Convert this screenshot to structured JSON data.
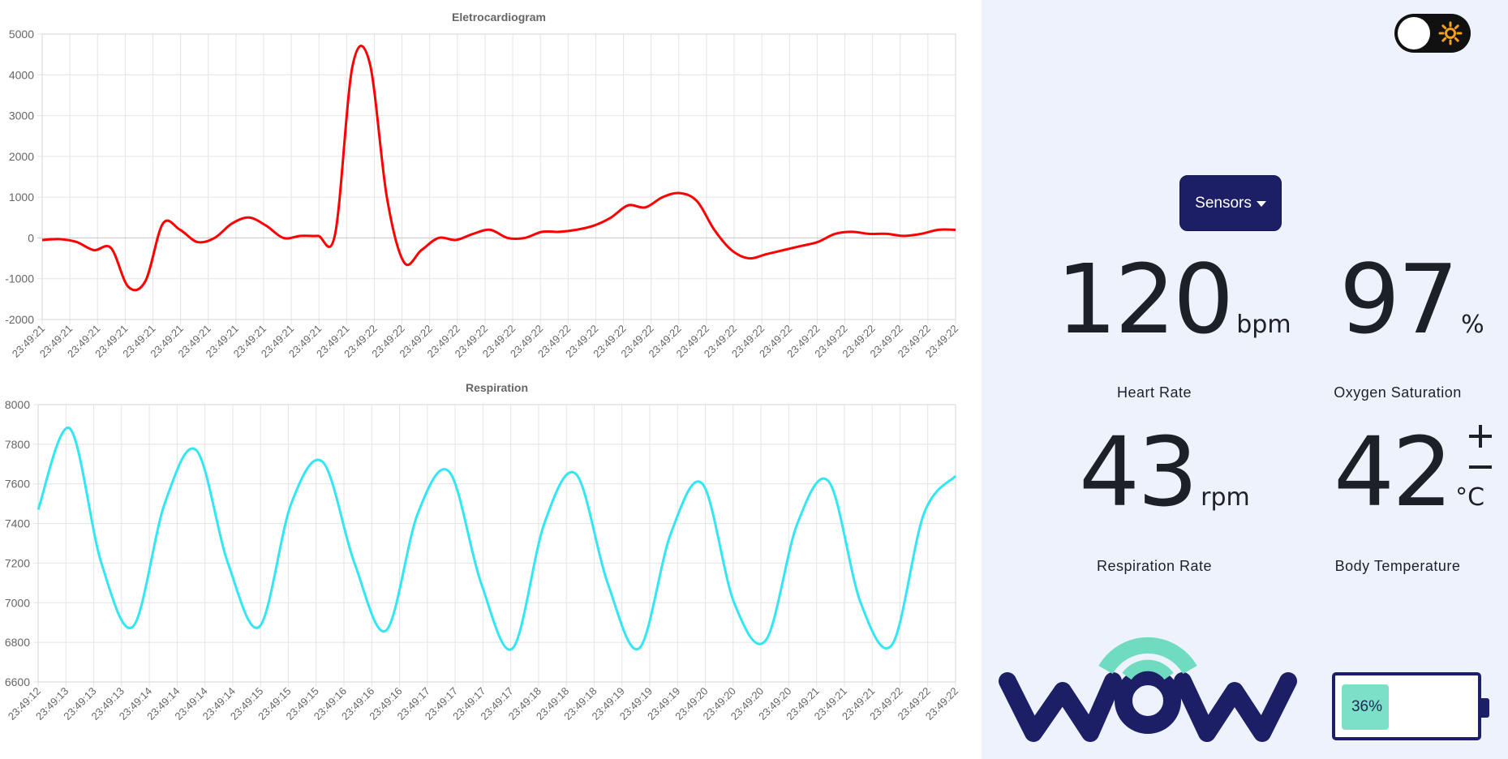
{
  "header": {
    "theme_toggle": {
      "state": "light",
      "icon": "sun-icon"
    }
  },
  "ecg_chart": {
    "chart_data": {
      "type": "line",
      "title": "Eletrocardiogram",
      "color": "#ff0000",
      "ylim": [
        -2000,
        5000
      ],
      "yticks": [
        -2000,
        -1000,
        0,
        1000,
        2000,
        3000,
        4000,
        5000
      ],
      "xticks": [
        "23:49:21",
        "23:49:21",
        "23:49:21",
        "23:49:21",
        "23:49:21",
        "23:49:21",
        "23:49:21",
        "23:49:21",
        "23:49:21",
        "23:49:21",
        "23:49:21",
        "23:49:21",
        "23:49:22",
        "23:49:22",
        "23:49:22",
        "23:49:22",
        "23:49:22",
        "23:49:22",
        "23:49:22",
        "23:49:22",
        "23:49:22",
        "23:49:22",
        "23:49:22",
        "23:49:22",
        "23:49:22",
        "23:49:22",
        "23:49:22",
        "23:49:22",
        "23:49:22",
        "23:49:22",
        "23:49:22",
        "23:49:22",
        "23:49:22",
        "23:49:22"
      ],
      "grid": true,
      "values": [
        -50,
        -30,
        -100,
        -300,
        -250,
        -1200,
        -1050,
        350,
        200,
        -100,
        0,
        350,
        500,
        300,
        0,
        50,
        50,
        100,
        4200,
        4300,
        1000,
        -600,
        -300,
        0,
        -50,
        100,
        200,
        0,
        0,
        150,
        150,
        200,
        300,
        500,
        800,
        750,
        1000,
        1100,
        900,
        200,
        -300,
        -500,
        -400,
        -300,
        -200,
        -100,
        100,
        150,
        100,
        100,
        50,
        100,
        200,
        200
      ]
    }
  },
  "resp_chart": {
    "chart_data": {
      "type": "line",
      "title": "Respiration",
      "color": "#33e6f4",
      "ylim": [
        6600,
        8000
      ],
      "yticks": [
        6600,
        6800,
        7000,
        7200,
        7400,
        7600,
        7800,
        8000
      ],
      "xticks": [
        "23:49:12",
        "23:49:13",
        "23:49:13",
        "23:49:13",
        "23:49:14",
        "23:49:14",
        "23:49:14",
        "23:49:14",
        "23:49:15",
        "23:49:15",
        "23:49:15",
        "23:49:16",
        "23:49:16",
        "23:49:16",
        "23:49:17",
        "23:49:17",
        "23:49:17",
        "23:49:17",
        "23:49:18",
        "23:49:18",
        "23:49:18",
        "23:49:19",
        "23:49:19",
        "23:49:19",
        "23:49:20",
        "23:49:20",
        "23:49:20",
        "23:49:20",
        "23:49:21",
        "23:49:21",
        "23:49:21",
        "23:49:22",
        "23:49:22",
        "23:49:22"
      ],
      "grid": true,
      "values": [
        7470,
        7880,
        7200,
        6880,
        7500,
        7770,
        7200,
        6880,
        7500,
        7710,
        7200,
        6860,
        7450,
        7660,
        7100,
        6770,
        7400,
        7650,
        7100,
        6770,
        7350,
        7600,
        7000,
        6810,
        7400,
        7610,
        7000,
        6790,
        7450,
        7640
      ]
    }
  },
  "sensors_button": {
    "label": "Sensors"
  },
  "metrics": {
    "heart_rate": {
      "value": "120",
      "unit": "bpm",
      "label": "Heart Rate"
    },
    "oxygen": {
      "value": "97",
      "unit": "%",
      "label": "Oxygen Saturation"
    },
    "respiration": {
      "value": "43",
      "unit": "rpm",
      "label": "Respiration Rate"
    },
    "temperature": {
      "value": "42",
      "unit": "°C",
      "label": "Body Temperature"
    }
  },
  "battery": {
    "level": 0.36,
    "text": "36%",
    "color": "#7be0c6"
  },
  "logo": {
    "name": "wow-logo",
    "text": "WOW",
    "colors": [
      "#1c1f66",
      "#6fdcbf"
    ]
  }
}
